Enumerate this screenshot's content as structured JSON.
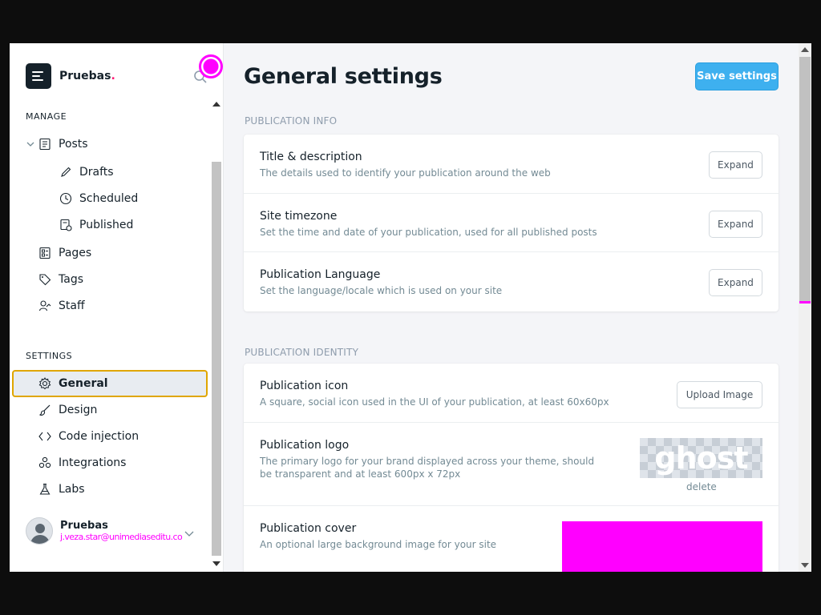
{
  "brand": {
    "name": "Pruebas",
    "dot": "."
  },
  "sidebar": {
    "manage_label": "MANAGE",
    "settings_label": "SETTINGS",
    "manage_items": [
      {
        "label": "Posts",
        "icon": "posts-icon"
      },
      {
        "label": "Drafts",
        "icon": "pencil-icon"
      },
      {
        "label": "Scheduled",
        "icon": "clock-icon"
      },
      {
        "label": "Published",
        "icon": "published-icon"
      },
      {
        "label": "Pages",
        "icon": "pages-icon"
      },
      {
        "label": "Tags",
        "icon": "tag-icon"
      },
      {
        "label": "Staff",
        "icon": "staff-icon"
      }
    ],
    "settings_items": [
      {
        "label": "General",
        "icon": "gear-icon"
      },
      {
        "label": "Design",
        "icon": "brush-icon"
      },
      {
        "label": "Code injection",
        "icon": "code-icon"
      },
      {
        "label": "Integrations",
        "icon": "integrations-icon"
      },
      {
        "label": "Labs",
        "icon": "flask-icon"
      }
    ],
    "user": {
      "name": "Pruebas",
      "email": "j.veza.star@unimediaseditu.co"
    }
  },
  "main": {
    "title": "General settings",
    "save_label": "Save settings",
    "publication_info": {
      "label": "PUBLICATION INFO",
      "rows": [
        {
          "title": "Title & description",
          "desc": "The details used to identify your publication around the web",
          "button": "Expand"
        },
        {
          "title": "Site timezone",
          "desc": "Set the time and date of your publication, used for all published posts",
          "button": "Expand"
        },
        {
          "title": "Publication Language",
          "desc": "Set the language/locale which is used on your site",
          "button": "Expand"
        }
      ]
    },
    "publication_identity": {
      "label": "PUBLICATION IDENTITY",
      "icon_row": {
        "title": "Publication icon",
        "desc": "A square, social icon used in the UI of your publication, at least 60x60px",
        "button": "Upload Image"
      },
      "logo_row": {
        "title": "Publication logo",
        "desc": "The primary logo for your brand displayed across your theme, should be transparent and at least 600px x 72px",
        "image_text": "ghost",
        "delete": "delete"
      },
      "cover_row": {
        "title": "Publication cover",
        "desc": "An optional large background image for your site"
      }
    }
  },
  "colors": {
    "accent": "#3eb0ef",
    "active_outline": "#e0a600",
    "cursor": "#ff00ff"
  }
}
